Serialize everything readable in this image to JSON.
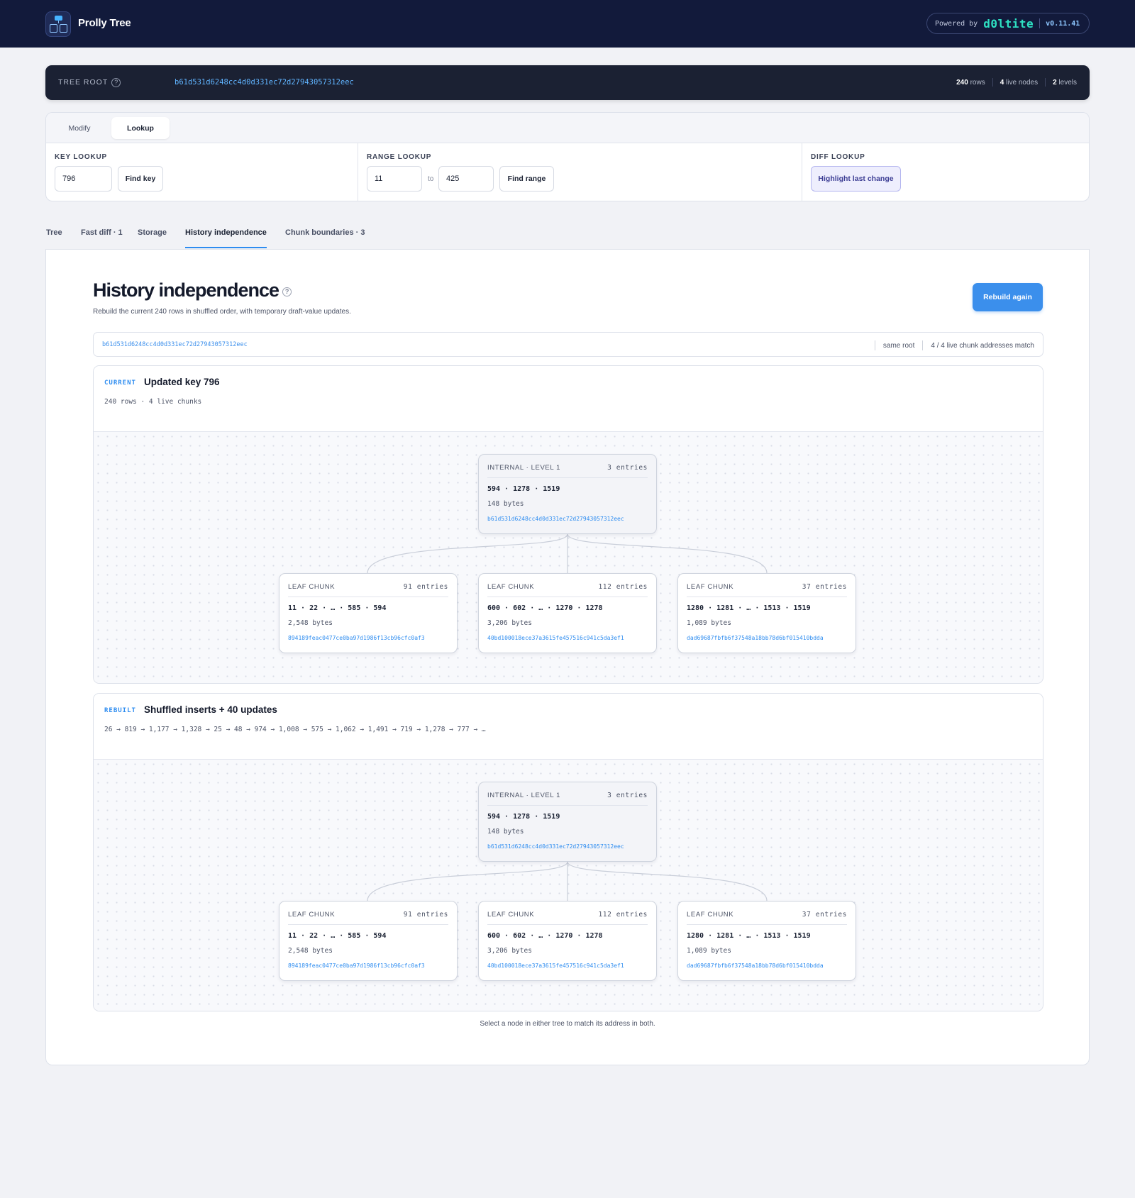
{
  "header": {
    "app_title": "Prolly Tree",
    "powered_by": "Powered by",
    "brand": "d0lt",
    "brand_suffix": "ite",
    "version": "v0.11.41"
  },
  "root_bar": {
    "label": "TREE ROOT",
    "help": "?",
    "hash": "b61d531d6248cc4d0d331ec72d27943057312eec",
    "rows_count": "240",
    "rows_label": "rows",
    "nodes_count": "4",
    "nodes_label": "live nodes",
    "levels_count": "2",
    "levels_label": "levels"
  },
  "lookup": {
    "modes": [
      "Modify",
      "Lookup"
    ],
    "active_mode": "Lookup",
    "key_lookup": {
      "title": "KEY LOOKUP",
      "value": "796",
      "button": "Find key"
    },
    "range_lookup": {
      "title": "RANGE LOOKUP",
      "from": "11",
      "to_label": "to",
      "to": "425",
      "button": "Find range"
    },
    "diff_lookup": {
      "title": "DIFF LOOKUP",
      "button": "Highlight last change"
    }
  },
  "tabs": [
    "Tree",
    "Fast diff · 1",
    "Storage",
    "History independence",
    "Chunk boundaries · 3"
  ],
  "active_tab": "History independence",
  "history": {
    "title": "History independence",
    "help": "?",
    "subtitle": "Rebuild the current 240 rows in shuffled order, with temporary draft-value updates.",
    "rebuild_button": "Rebuild again",
    "root_hash": "b61d531d6248cc4d0d331ec72d27943057312eec",
    "same_root": "same root",
    "match_text": "4 / 4 live chunk addresses match",
    "footer": "Select a node in either tree to match its address in both."
  },
  "trees": [
    {
      "tag": "CURRENT",
      "title": "Updated key 796",
      "meta": "240 rows · 4 live chunks",
      "internal": {
        "kind": "INTERNAL · LEVEL 1",
        "entries": "3 entries",
        "keys": "594 · 1278 · 1519",
        "bytes": "148 bytes",
        "address": "b61d531d6248cc4d0d331ec72d27943057312eec"
      },
      "leaves": [
        {
          "kind": "LEAF CHUNK",
          "entries": "91 entries",
          "keys": "11 · 22 · … · 585 · 594",
          "bytes": "2,548 bytes",
          "address": "894189feac0477ce0ba97d1986f13cb96cfc0af3"
        },
        {
          "kind": "LEAF CHUNK",
          "entries": "112 entries",
          "keys": "600 · 602 · … · 1270 · 1278",
          "bytes": "3,206 bytes",
          "address": "40bd100018ece37a3615fe457516c941c5da3ef1"
        },
        {
          "kind": "LEAF CHUNK",
          "entries": "37 entries",
          "keys": "1280 · 1281 · … · 1513 · 1519",
          "bytes": "1,089 bytes",
          "address": "dad69687fbfb6f37548a18bb78d6bf015410bdda"
        }
      ]
    },
    {
      "tag": "REBUILT",
      "title": "Shuffled inserts + 40 updates",
      "meta": "26 → 819 → 1,177 → 1,328 → 25 → 48 → 974 → 1,008 → 575 → 1,062 → 1,491 → 719 → 1,278 → 777 → …",
      "internal": {
        "kind": "INTERNAL · LEVEL 1",
        "entries": "3 entries",
        "keys": "594 · 1278 · 1519",
        "bytes": "148 bytes",
        "address": "b61d531d6248cc4d0d331ec72d27943057312eec"
      },
      "leaves": [
        {
          "kind": "LEAF CHUNK",
          "entries": "91 entries",
          "keys": "11 · 22 · … · 585 · 594",
          "bytes": "2,548 bytes",
          "address": "894189feac0477ce0ba97d1986f13cb96cfc0af3"
        },
        {
          "kind": "LEAF CHUNK",
          "entries": "112 entries",
          "keys": "600 · 602 · … · 1270 · 1278",
          "bytes": "3,206 bytes",
          "address": "40bd100018ece37a3615fe457516c941c5da3ef1"
        },
        {
          "kind": "LEAF CHUNK",
          "entries": "37 entries",
          "keys": "1280 · 1281 · … · 1513 · 1519",
          "bytes": "1,089 bytes",
          "address": "dad69687fbfb6f37548a18bb78d6bf015410bdda"
        }
      ]
    }
  ],
  "colors": {
    "accent": "#2d8cf0",
    "header_bg": "#121a3b",
    "root_bg": "#1b2133",
    "brand_teal": "#2ee0c2"
  },
  "icons": {
    "logo": "tree-logo-icon",
    "help": "help-icon"
  }
}
